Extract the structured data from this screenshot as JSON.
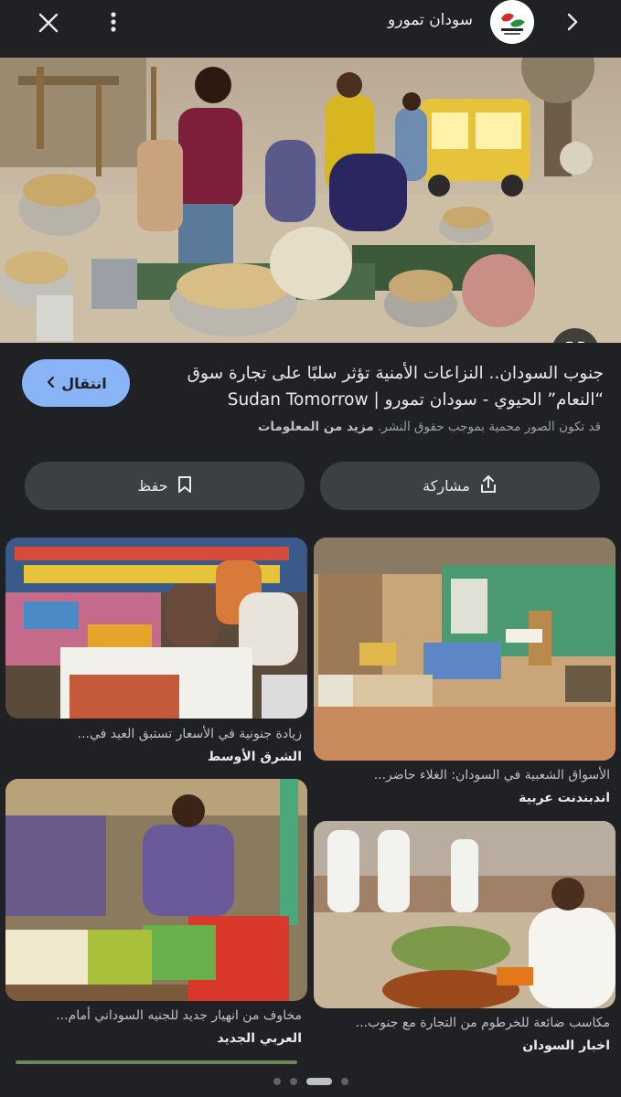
{
  "topbar": {
    "source_name": "سودان تمورو",
    "close_icon": "close-icon",
    "more_icon": "more-vert-icon",
    "forward_icon": "chevron-right-icon"
  },
  "result": {
    "title": "جنوب السودان.. النزاعات الأمنية تؤثر سلبًا على تجارة سوق “النعام” الحيوي - سودان تمورو | Sudan Tomorrow",
    "visit_label": "انتقال",
    "copyright_text": "قد تكون الصور محمية بموجب حقوق النشر.",
    "more_info": "مزيد من المعلومات"
  },
  "actions": {
    "share_label": "مشاركة",
    "save_label": "حفظ"
  },
  "related": [
    {
      "caption": "الأسواق الشعبية في السودان: الغلاء حاضر...",
      "source": "اندبندنت عربية"
    },
    {
      "caption": "زيادة جنونية في الأسعار تستبق العيد في...",
      "source": "الشرق الأوسط"
    },
    {
      "caption": "مكاسب ضائعة للخرطوم من التجارة مع جنوب...",
      "source": "اخبار السودان"
    },
    {
      "caption": "مخاوف من انهيار جديد للجنيه السوداني أمام...",
      "source": "العربي الجديد"
    }
  ],
  "pagination": {
    "count": 4,
    "active": 2
  },
  "colors": {
    "background": "#202124",
    "accent": "#8ab4f8",
    "button": "#3c4043"
  }
}
